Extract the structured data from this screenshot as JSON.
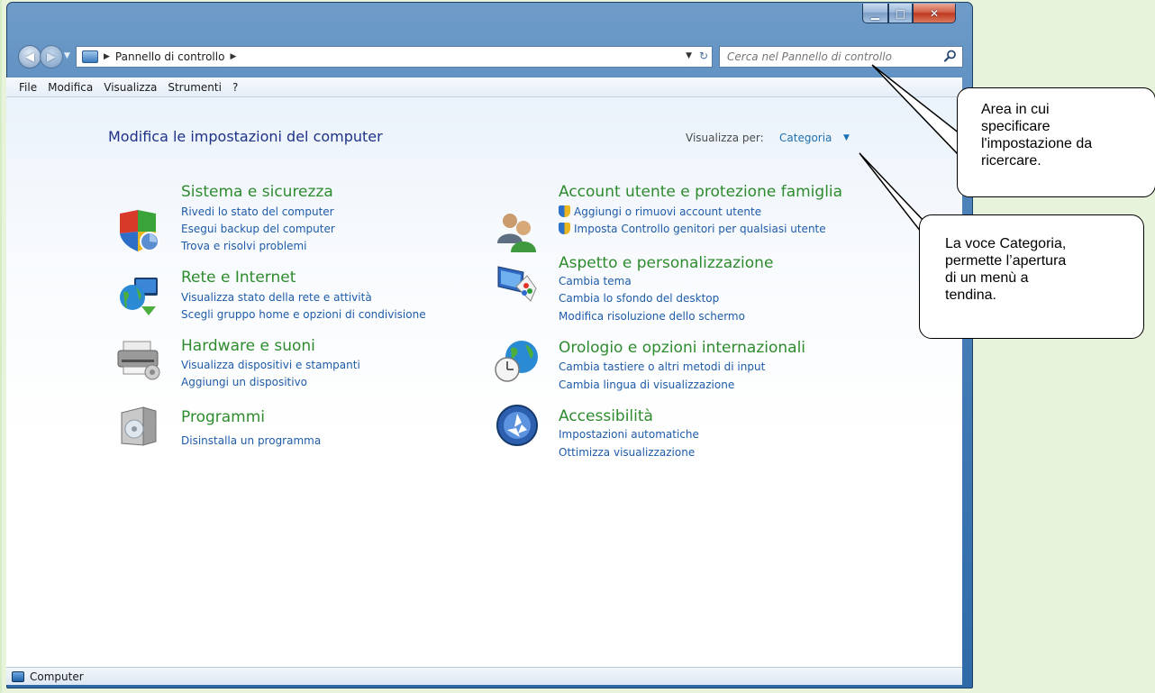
{
  "window": {
    "controls": {
      "minimize": "▁",
      "maximize": "□",
      "close": "✕"
    }
  },
  "address": {
    "breadcrumb": "Pannello di controllo",
    "search_placeholder": "Cerca nel Pannello di controllo"
  },
  "menu": [
    "File",
    "Modifica",
    "Visualizza",
    "Strumenti",
    "?"
  ],
  "content": {
    "title": "Modifica le impostazioni del computer",
    "view_by_label": "Visualizza per:",
    "view_by_value": "Categoria"
  },
  "categories": [
    {
      "title": "Sistema e sicurezza",
      "icon": "shield-icon",
      "links": [
        "Rivedi lo stato del computer",
        "Esegui backup del computer",
        "Trova e risolvi problemi"
      ]
    },
    {
      "title": "Rete e Internet",
      "icon": "network-globe-icon",
      "links": [
        "Visualizza stato della rete e attività",
        "Scegli gruppo home e opzioni di condivisione"
      ]
    },
    {
      "title": "Hardware e suoni",
      "icon": "printer-icon",
      "links": [
        "Visualizza dispositivi e stampanti",
        "Aggiungi un dispositivo"
      ]
    },
    {
      "title": "Programmi",
      "icon": "programs-icon",
      "links": [
        "Disinstalla un programma"
      ]
    },
    {
      "title": "Account utente e protezione famiglia",
      "icon": "users-icon",
      "links": [
        "Aggiungi o rimuovi account utente",
        "Imposta Controllo genitori per qualsiasi utente"
      ]
    },
    {
      "title": "Aspetto e personalizzazione",
      "icon": "display-icon",
      "links": [
        "Cambia tema",
        "Cambia lo sfondo del desktop",
        "Modifica risoluzione dello schermo"
      ]
    },
    {
      "title": "Orologio e opzioni internazionali",
      "icon": "clock-globe-icon",
      "links": [
        "Cambia tastiere o altri metodi di input",
        "Cambia lingua di visualizzazione"
      ]
    },
    {
      "title": "Accessibilità",
      "icon": "accessibility-icon",
      "links": [
        "Impostazioni automatiche",
        "Ottimizza visualizzazione"
      ]
    }
  ],
  "statusbar": {
    "text": "Computer"
  },
  "callouts": [
    {
      "lines": [
        "Area in cui",
        "specificare",
        "l'impostazione da",
        "ricercare."
      ]
    },
    {
      "lines": [
        "La voce Categoria,",
        "permette l’apertura",
        "di un menù a",
        "tendina."
      ]
    }
  ]
}
